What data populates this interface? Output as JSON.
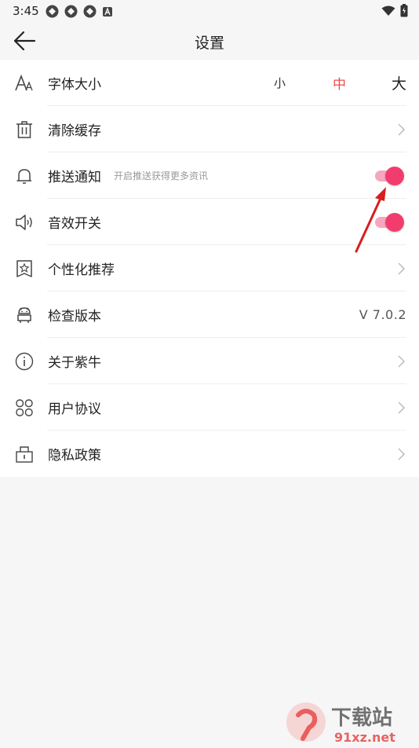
{
  "status_bar": {
    "time": "3:45",
    "notification_icons": [
      "notification-icon",
      "notification-icon",
      "notification-icon",
      "app-a-icon"
    ],
    "right_icons": [
      "wifi-icon",
      "battery-icon"
    ]
  },
  "header": {
    "title": "设置",
    "back_icon": "back-arrow-icon"
  },
  "settings": {
    "font_size": {
      "label": "字体大小",
      "icon": "font-size-icon",
      "options": [
        "小",
        "中",
        "大"
      ],
      "selected": "中"
    },
    "clear_cache": {
      "label": "清除缓存",
      "icon": "trash-icon"
    },
    "push_notify": {
      "label": "推送通知",
      "sub": "开启推送获得更多资讯",
      "icon": "bell-icon",
      "enabled": true
    },
    "sound": {
      "label": "音效开关",
      "icon": "speaker-icon",
      "enabled": true
    },
    "personal_rec": {
      "label": "个性化推荐",
      "icon": "star-badge-icon"
    },
    "check_version": {
      "label": "检查版本",
      "icon": "android-icon",
      "value": "V 7.0.2"
    },
    "about": {
      "label": "关于紫牛",
      "icon": "info-icon"
    },
    "user_agreement": {
      "label": "用户协议",
      "icon": "grid-icon"
    },
    "privacy": {
      "label": "隐私政策",
      "icon": "lock-icon"
    }
  },
  "watermark": {
    "text": "下载站",
    "subtext": "91xz.net"
  },
  "colors": {
    "accent_red": "#ef4b4b",
    "toggle_on": "#f23c6e",
    "toggle_track": "#f6a7bd",
    "annotation_arrow": "#d81e1e"
  }
}
